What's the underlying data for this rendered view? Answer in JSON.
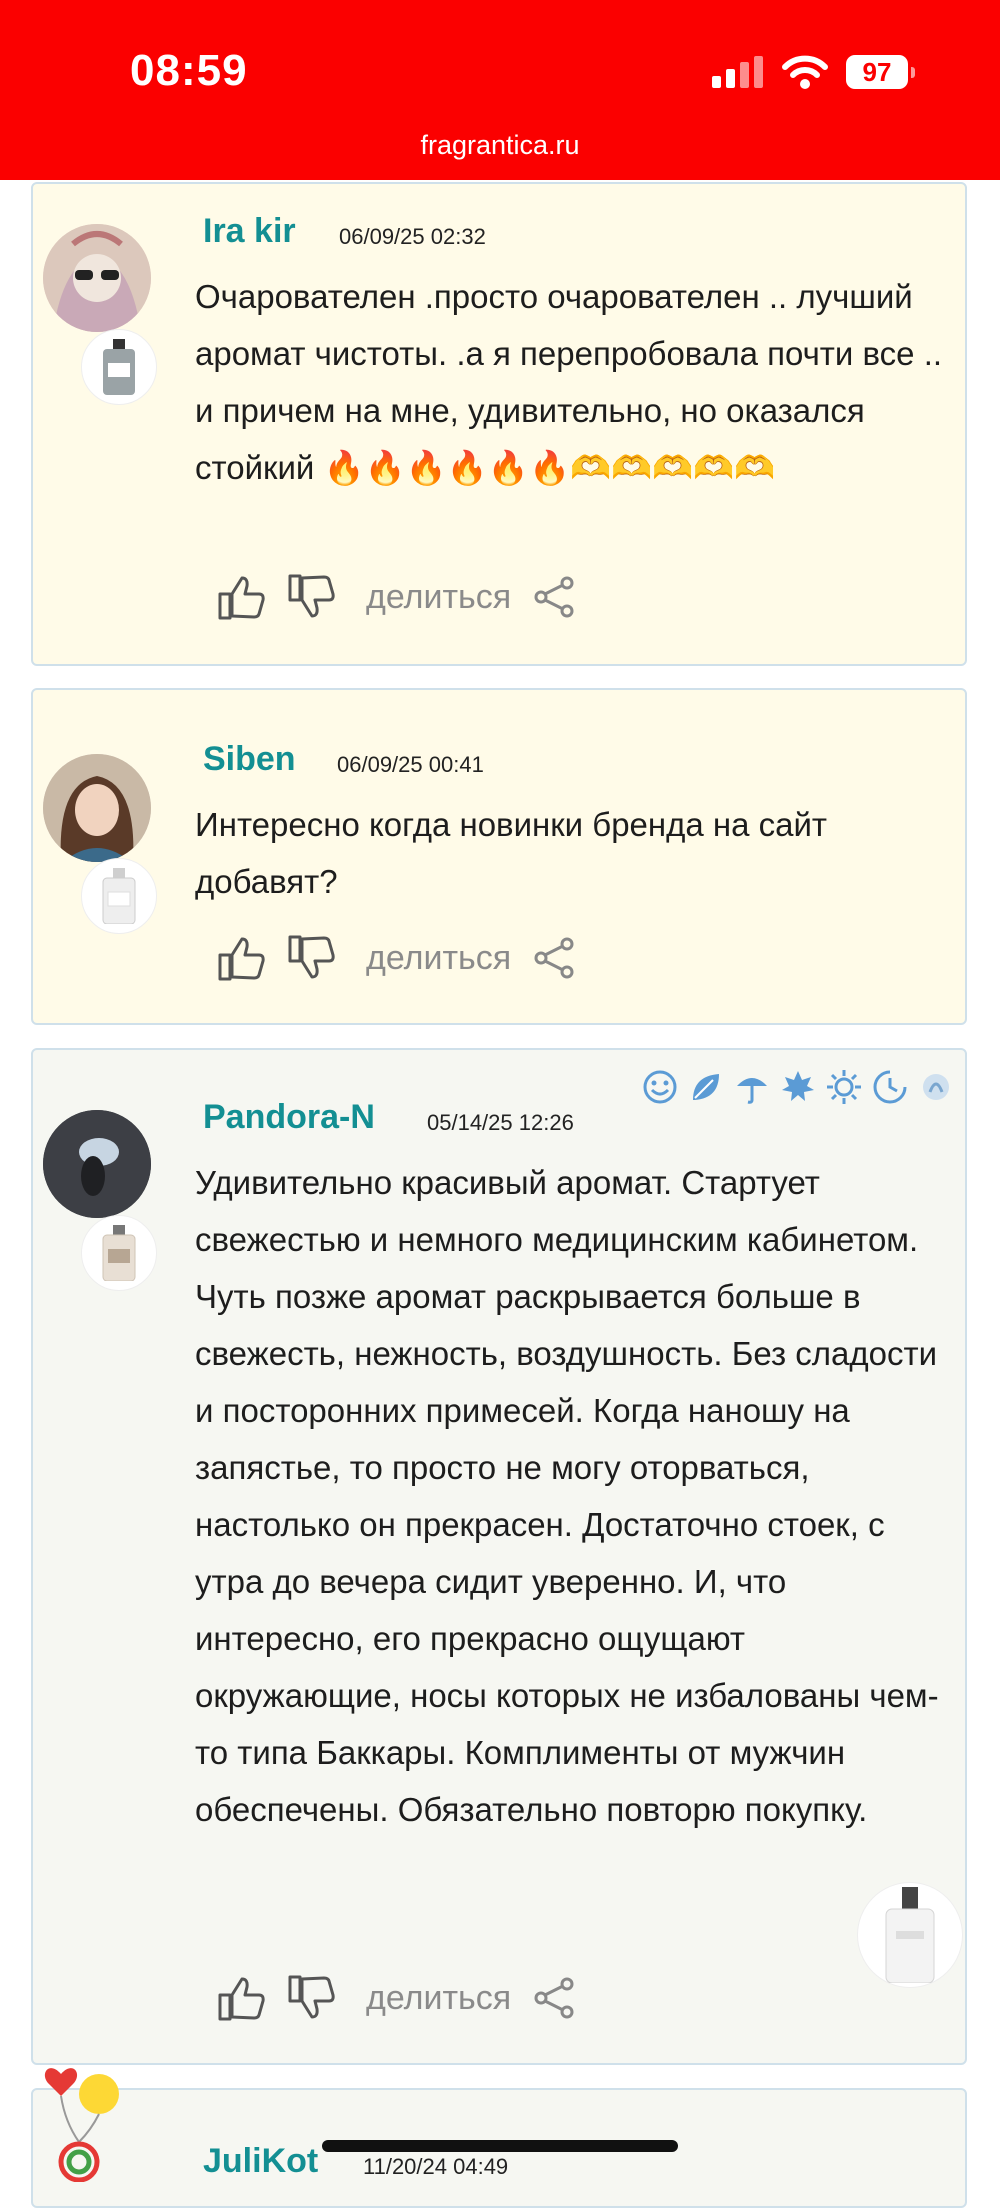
{
  "status": {
    "time": "08:59",
    "battery": "97"
  },
  "browser": {
    "url": "fragrantica.ru"
  },
  "reviews": [
    {
      "user": "Ira kir",
      "date": "06/09/25 02:32",
      "text": "Очарователен .просто очарователен .. лучший аромат чистоты. .а я перепробовала почти все .. и причем на мне, удивительно, но оказался стойкий 🔥🔥🔥🔥🔥🔥🫶🫶🫶🫶🫶",
      "share": "делиться"
    },
    {
      "user": "Siben",
      "date": "06/09/25 00:41",
      "text": "Интересно когда новинки бренда на сайт добавят?",
      "share": "делиться"
    },
    {
      "user": "Pandora-N",
      "date": "05/14/25 12:26",
      "text": "Удивительно красивый аромат. Стартует свежестью и немного медицинским кабинетом. Чуть позже аромат раскрывается больше в свежесть, нежность, воздушность. Без сладости и посторонних примесей. Когда наношу на запястье, то просто не могу оторваться, настолько он прекрасен. Достаточно стоек, с утра до вечера сидит уверенно. И, что интересно, его прекрасно ощущают окружающие, носы которых не избалованы чем-то типа Баккары. Комплименты от мужчин обеспечены. Обязательно повторю покупку.",
      "share": "делиться"
    },
    {
      "user": "JuliKot",
      "date": "11/20/24 04:49"
    }
  ]
}
